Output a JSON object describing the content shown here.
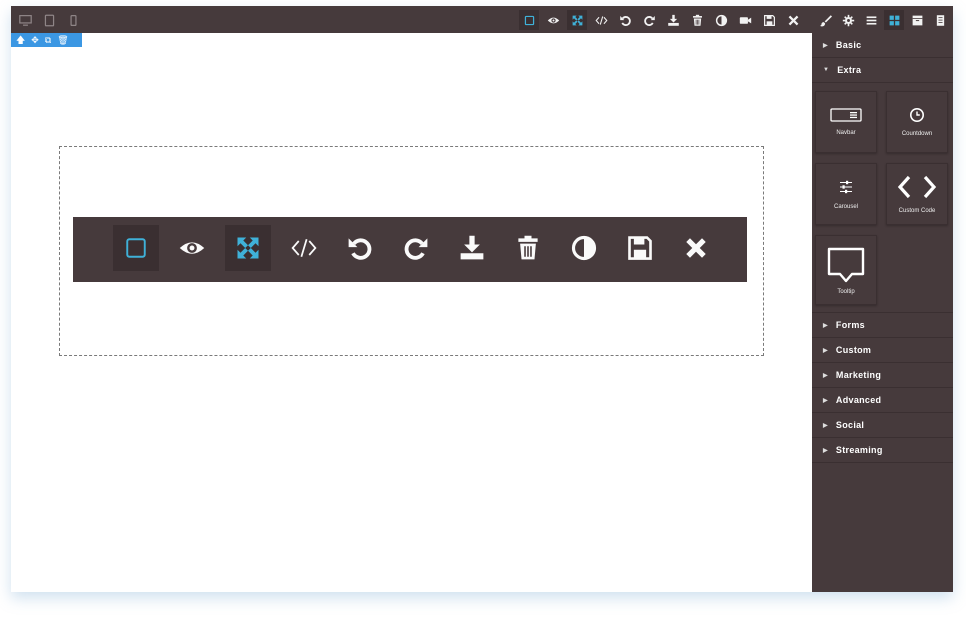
{
  "topbar": {
    "devices": [
      {
        "name": "desktop-icon"
      },
      {
        "name": "tablet-icon"
      },
      {
        "name": "mobile-icon"
      }
    ],
    "options": [
      {
        "name": "sw-visibility-icon",
        "active": true
      },
      {
        "name": "preview-icon",
        "active": false
      },
      {
        "name": "fullscreen-icon",
        "active": true
      },
      {
        "name": "code-icon",
        "active": false
      },
      {
        "name": "undo-icon",
        "active": false
      },
      {
        "name": "redo-icon",
        "active": false
      },
      {
        "name": "download-icon",
        "active": false
      },
      {
        "name": "trash-icon",
        "active": false
      },
      {
        "name": "contrast-icon",
        "active": false
      },
      {
        "name": "video-icon",
        "active": false
      },
      {
        "name": "save-icon",
        "active": false
      },
      {
        "name": "close-icon",
        "active": false
      }
    ],
    "views": [
      {
        "name": "brush-icon",
        "active": false
      },
      {
        "name": "gear-icon",
        "active": false
      },
      {
        "name": "layers-icon",
        "active": false
      },
      {
        "name": "blocks-icon",
        "active": true
      },
      {
        "name": "archive-icon",
        "active": false
      },
      {
        "name": "pages-icon",
        "active": false
      }
    ]
  },
  "canvas": {
    "selection_toolbar": [
      "arrow-up-icon",
      "move-icon",
      "clone-icon",
      "trash-icon"
    ],
    "component_toolbar": [
      {
        "name": "sw-visibility-icon",
        "active": true
      },
      {
        "name": "preview-icon",
        "active": false
      },
      {
        "name": "fullscreen-icon",
        "active": true
      },
      {
        "name": "code-icon",
        "active": false
      },
      {
        "name": "undo-icon",
        "active": false
      },
      {
        "name": "redo-icon",
        "active": false
      },
      {
        "name": "download-icon",
        "active": false
      },
      {
        "name": "trash-icon",
        "active": false
      },
      {
        "name": "contrast-icon",
        "active": false
      },
      {
        "name": "save-icon",
        "active": false
      },
      {
        "name": "close-icon",
        "active": false
      }
    ]
  },
  "panel": {
    "categories_top": [
      {
        "label": "Basic",
        "open": false
      },
      {
        "label": "Extra",
        "open": true
      }
    ],
    "blocks": [
      {
        "label": "Navbar",
        "icon": "navbar-icon"
      },
      {
        "label": "Countdown",
        "icon": "clock-icon"
      },
      {
        "label": "Carousel",
        "icon": "sliders-icon"
      },
      {
        "label": "Custom Code",
        "icon": "code-icon"
      },
      {
        "label": "Tooltip",
        "icon": "tooltip-icon"
      }
    ],
    "categories_bottom": [
      {
        "label": "Forms"
      },
      {
        "label": "Custom"
      },
      {
        "label": "Marketing"
      },
      {
        "label": "Advanced"
      },
      {
        "label": "Social"
      },
      {
        "label": "Streaming"
      }
    ]
  },
  "colors": {
    "panel_bg": "#463a3c",
    "accent": "#3fb1d8",
    "selection": "#3b97e3"
  }
}
